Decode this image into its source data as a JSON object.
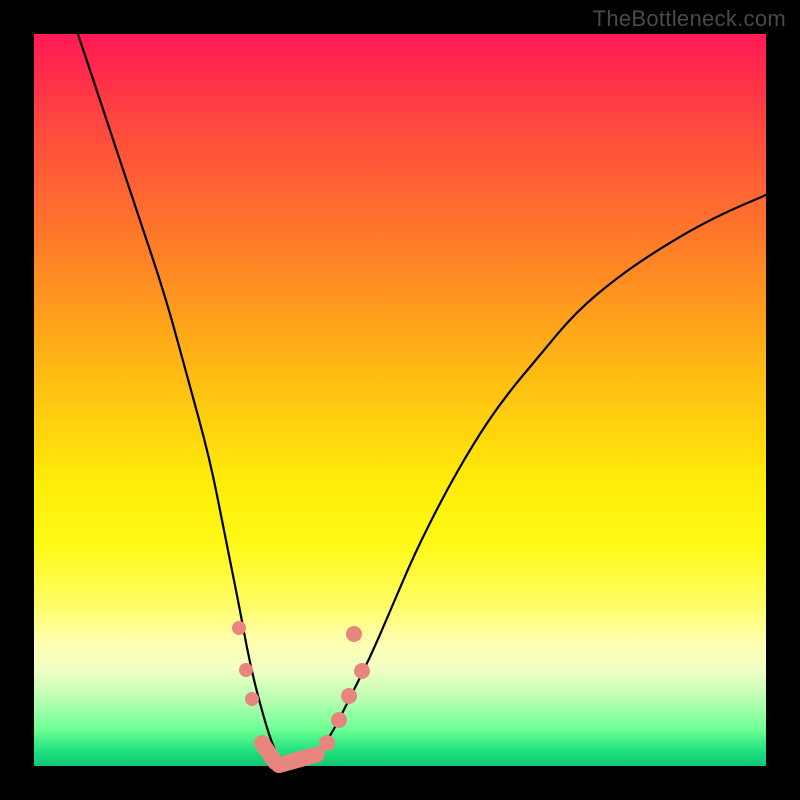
{
  "watermark": "TheBottleneck.com",
  "chart_data": {
    "type": "line",
    "title": "",
    "xlabel": "",
    "ylabel": "",
    "xlim": [
      0,
      100
    ],
    "ylim": [
      0,
      100
    ],
    "series": [
      {
        "name": "bottleneck-curve",
        "x": [
          6,
          10,
          14,
          18,
          21,
          24,
          26,
          28,
          29.5,
          31,
          32.5,
          34,
          36,
          38,
          40.5,
          43,
          46,
          49,
          52,
          56,
          60,
          64,
          69,
          74,
          80,
          86,
          93,
          100
        ],
        "y": [
          100,
          88,
          76,
          64,
          53,
          42,
          32,
          22,
          14,
          8,
          3,
          0,
          0,
          1,
          4,
          9,
          15,
          22,
          29,
          37,
          44,
          50,
          56,
          62,
          67,
          71,
          75,
          78
        ]
      }
    ],
    "markers": [
      {
        "kind": "dot",
        "x": 28.0,
        "y": 18.8,
        "r": 7
      },
      {
        "kind": "dot",
        "x": 29.0,
        "y": 13.1,
        "r": 7
      },
      {
        "kind": "dot",
        "x": 29.8,
        "y": 9.2,
        "r": 7
      },
      {
        "kind": "capsule",
        "x1": 31.2,
        "y1": 3.2,
        "x2": 33.0,
        "y2": 0.6,
        "w": 16
      },
      {
        "kind": "capsule",
        "x1": 33.5,
        "y1": 0.2,
        "x2": 38.6,
        "y2": 1.6,
        "w": 16
      },
      {
        "kind": "dot",
        "x": 40.0,
        "y": 3.2,
        "r": 8
      },
      {
        "kind": "dot",
        "x": 41.6,
        "y": 6.3,
        "r": 8
      },
      {
        "kind": "dot",
        "x": 43.0,
        "y": 9.6,
        "r": 8
      },
      {
        "kind": "dot",
        "x": 44.8,
        "y": 13.0,
        "r": 8
      },
      {
        "kind": "dot",
        "x": 43.7,
        "y": 18.0,
        "r": 8
      }
    ],
    "colors": {
      "curve": "#000000",
      "marker": "#e8867e",
      "gradient_top": "#ff1a55",
      "gradient_bottom": "#0fc774"
    }
  }
}
